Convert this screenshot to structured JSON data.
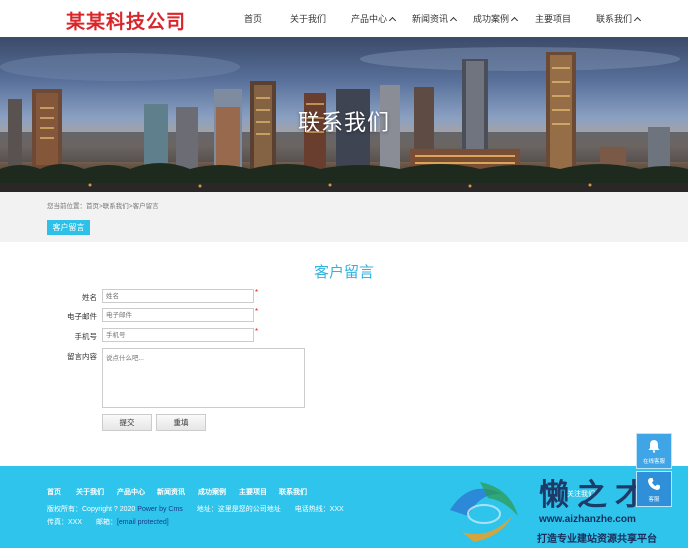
{
  "header": {
    "logo": "某某科技公司",
    "nav": [
      {
        "label": "首页",
        "dropdown": false
      },
      {
        "label": "关于我们",
        "dropdown": false
      },
      {
        "label": "产品中心",
        "dropdown": true
      },
      {
        "label": "新闻资讯",
        "dropdown": true
      },
      {
        "label": "成功案例",
        "dropdown": true
      },
      {
        "label": "主要项目",
        "dropdown": false
      },
      {
        "label": "联系我们",
        "dropdown": true
      }
    ]
  },
  "banner": {
    "title": "联系我们"
  },
  "breadcrumb": {
    "prefix": "您当前位置：",
    "items": [
      "首页",
      "联系我们",
      "客户留言"
    ],
    "separator": ">"
  },
  "sub_tab": "客户留言",
  "form": {
    "title": "客户留言",
    "fields": [
      {
        "label": "姓名",
        "placeholder": "姓名",
        "required": true
      },
      {
        "label": "电子邮件",
        "placeholder": "电子邮件",
        "required": true
      },
      {
        "label": "手机号",
        "placeholder": "手机号",
        "required": true
      }
    ],
    "message": {
      "label": "留言内容",
      "placeholder": "说点什么吧..."
    },
    "required_mark": "*",
    "submit_label": "提交",
    "reset_label": "重填"
  },
  "footer": {
    "nav": [
      "首页",
      "关于我们",
      "产品中心",
      "新闻资讯",
      "成功案例",
      "主要项目",
      "联系我们"
    ],
    "copyright_prefix": "版权所有：Copyright ? 2020",
    "power_link": "Power by Cms",
    "address": "地址：这里是您的公司地址",
    "phone": "电话热线：XXX",
    "fax": "传真：XXX",
    "email_label": "邮箱：",
    "email": "[email protected]"
  },
  "float": {
    "service": "在线客服",
    "follow": "关注我们",
    "phone_label": "客服"
  },
  "watermark": {
    "big": "懒之才",
    "url": "www.aizhanzhe.com",
    "tagline": "打造专业建站资源共享平台"
  },
  "colors": {
    "logo": "#d9262b",
    "accent": "#2fc0e8",
    "footer": "#2fc4ec",
    "required": "#e02020"
  }
}
